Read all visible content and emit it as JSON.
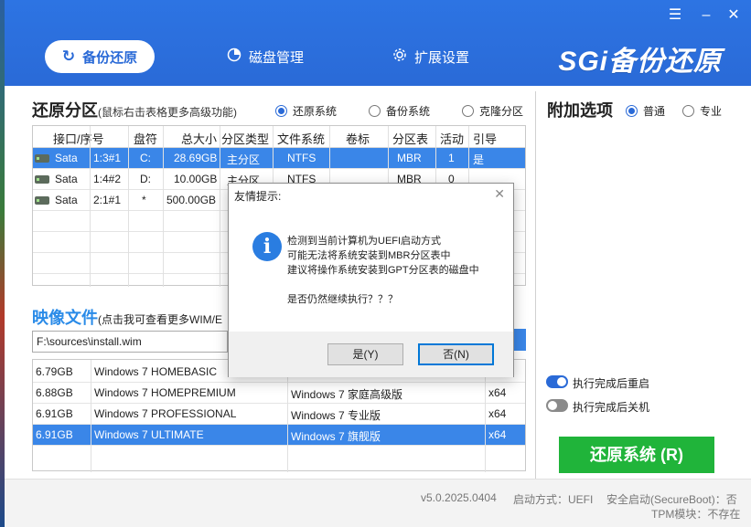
{
  "header": {
    "tabs": [
      {
        "label": "备份还原",
        "icon": "refresh-icon",
        "active": true
      },
      {
        "label": "磁盘管理",
        "icon": "pie-chart-icon",
        "active": false
      },
      {
        "label": "扩展设置",
        "icon": "gear-icon",
        "active": false
      }
    ],
    "brand": "SGi备份还原",
    "controls": [
      "menu-icon",
      "minimize-icon",
      "close-icon"
    ]
  },
  "partition": {
    "title": "还原分区",
    "subtitle": "(鼠标右击表格更多高级功能)",
    "modes": [
      {
        "label": "还原系统",
        "checked": true
      },
      {
        "label": "备份系统",
        "checked": false
      },
      {
        "label": "克隆分区",
        "checked": false
      }
    ],
    "columns": [
      "接口/序号",
      "盘符",
      "总大小",
      "分区类型",
      "文件系统",
      "卷标",
      "分区表",
      "活动",
      "引导"
    ],
    "rows": [
      {
        "iface": "Sata",
        "num": "1:3#1",
        "drive": "C:",
        "size": "28.69GB",
        "type": "主分区",
        "fs": "NTFS",
        "label": "",
        "table": "MBR",
        "active": "1",
        "boot": "是",
        "selected": true
      },
      {
        "iface": "Sata",
        "num": "1:4#2",
        "drive": "D:",
        "size": "10.00GB",
        "type": "主分区",
        "fs": "NTFS",
        "label": "",
        "table": "MBR",
        "active": "0",
        "boot": "",
        "selected": false
      },
      {
        "iface": "Sata",
        "num": "2:1#1",
        "drive": "*",
        "size": "500.00GB",
        "type": "",
        "fs": "",
        "label": "",
        "table": "",
        "active": "",
        "boot": "",
        "selected": false
      }
    ]
  },
  "image": {
    "title": "映像文件",
    "subtitle": "(点击我可查看更多WIM/E",
    "path": "F:\\sources\\install.wim",
    "rows": [
      {
        "size": "6.79GB",
        "name": "Windows 7 HOMEBASIC",
        "cn": "",
        "arch": "",
        "selected": false
      },
      {
        "size": "6.88GB",
        "name": "Windows 7 HOMEPREMIUM",
        "cn": "Windows 7 家庭高级版",
        "arch": "x64",
        "selected": false
      },
      {
        "size": "6.91GB",
        "name": "Windows 7 PROFESSIONAL",
        "cn": "Windows 7 专业版",
        "arch": "x64",
        "selected": false
      },
      {
        "size": "6.91GB",
        "name": "Windows 7 ULTIMATE",
        "cn": "Windows 7 旗舰版",
        "arch": "x64",
        "selected": true
      }
    ]
  },
  "options": {
    "title": "附加选项",
    "modes": [
      {
        "label": "普通",
        "checked": true
      },
      {
        "label": "专业",
        "checked": false
      }
    ],
    "toggles": [
      {
        "label": "执行完成后重启",
        "on": true
      },
      {
        "label": "执行完成后关机",
        "on": false
      }
    ],
    "restore_button": "还原系统 (R)"
  },
  "footer": {
    "version": "v5.0.2025.0404",
    "boot_mode": "启动方式：UEFI",
    "secure_boot": "安全启动(SecureBoot)：否",
    "tpm": "TPM模块：不存在"
  },
  "dialog": {
    "title": "友情提示:",
    "icon": "info-icon",
    "lines": [
      "检测到当前计算机为UEFI启动方式",
      "可能无法将系统安装到MBR分区表中",
      "建议将操作系统安装到GPT分区表的磁盘中",
      "是否仍然继续执行？？？"
    ],
    "yes_label": "是(Y)",
    "no_label": "否(N)"
  },
  "colors": {
    "accent": "#2a6ad7",
    "selection": "#3a86e8",
    "restore": "#20b43a",
    "image_title": "#2a8be8"
  }
}
